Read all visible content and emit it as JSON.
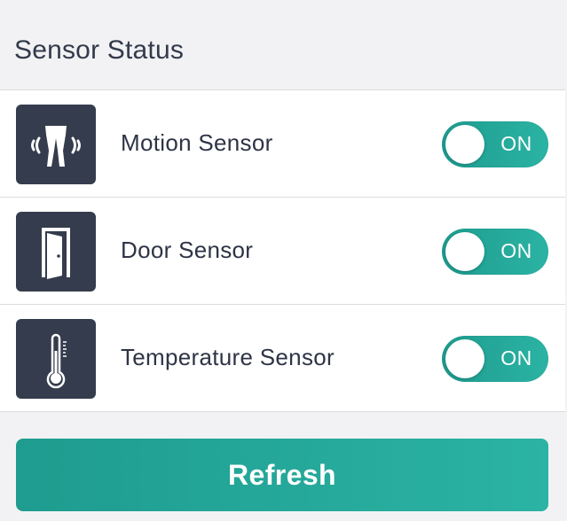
{
  "header": {
    "title": "Sensor Status"
  },
  "sensors": [
    {
      "label": "Motion Sensor",
      "icon": "motion-icon",
      "toggle_label": "ON",
      "enabled": true
    },
    {
      "label": "Door Sensor",
      "icon": "door-icon",
      "toggle_label": "ON",
      "enabled": true
    },
    {
      "label": "Temperature Sensor",
      "icon": "thermometer-icon",
      "toggle_label": "ON",
      "enabled": true
    }
  ],
  "actions": {
    "refresh_label": "Refresh"
  },
  "colors": {
    "accent_start": "#1e9c8f",
    "accent_end": "#2bb3a3",
    "tile_bg": "#343c4d",
    "text": "#2e3446"
  }
}
